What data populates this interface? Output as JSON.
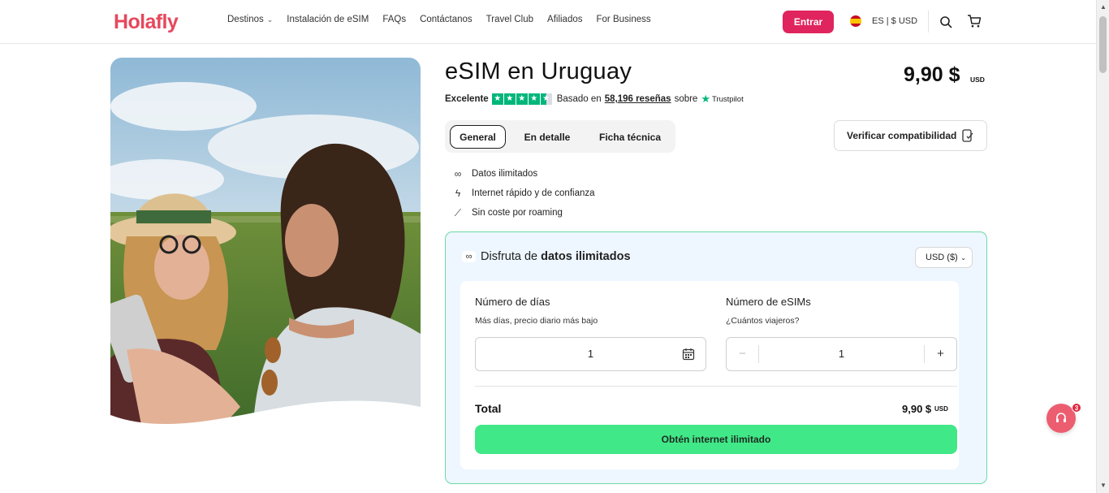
{
  "header": {
    "logo": "Holafly",
    "nav": [
      {
        "label": "Destinos",
        "has_dropdown": true
      },
      {
        "label": "Instalación de eSIM"
      },
      {
        "label": "FAQs"
      },
      {
        "label": "Contáctanos"
      },
      {
        "label": "Travel Club"
      },
      {
        "label": "Afiliados"
      },
      {
        "label": "For Business"
      }
    ],
    "login_label": "Entrar",
    "language_currency": "ES | $ USD",
    "icons": {
      "flag": "spain-flag-icon",
      "search": "search-icon",
      "cart": "cart-icon"
    }
  },
  "product": {
    "title": "eSIM en Uruguay",
    "price": "9,90 $",
    "price_currency": "USD",
    "rating": {
      "label": "Excelente",
      "based_on": "Basado en",
      "reviews_link": "58,196 reseñas",
      "on": "sobre",
      "provider": "Trustpilot",
      "stars": 4.5
    },
    "tabs": [
      {
        "label": "General",
        "active": true
      },
      {
        "label": "En detalle"
      },
      {
        "label": "Ficha técnica"
      }
    ],
    "compat_button": "Verificar compatibilidad",
    "features": [
      {
        "icon": "infinity-icon",
        "glyph": "∞",
        "label": "Datos ilimitados"
      },
      {
        "icon": "lightning-icon",
        "glyph": "ϟ",
        "label": "Internet rápido y de confianza"
      },
      {
        "icon": "no-roaming-icon",
        "glyph": "⟋",
        "label": "Sin coste por roaming"
      }
    ]
  },
  "plan_box": {
    "heading_prefix": "Disfruta de",
    "heading_bold": "datos ilimitados",
    "currency_select": "USD ($)",
    "days": {
      "label": "Número de días",
      "sub": "Más días, precio diario más bajo",
      "value": "1"
    },
    "esims": {
      "label": "Número de eSIMs",
      "sub": "¿Cuántos viajeros?",
      "value": "1",
      "minus": "−",
      "plus": "+"
    },
    "total_label": "Total",
    "total_value": "9,90 $",
    "total_currency": "USD",
    "cta": "Obtén internet ilimitado"
  },
  "chat": {
    "badge": "3"
  },
  "colors": {
    "brand": "#e6485d",
    "login": "#e0245e",
    "trustpilot": "#00b67a",
    "cta": "#41e887",
    "box_border": "#6dd9a4",
    "box_bg": "#eef7ff"
  }
}
